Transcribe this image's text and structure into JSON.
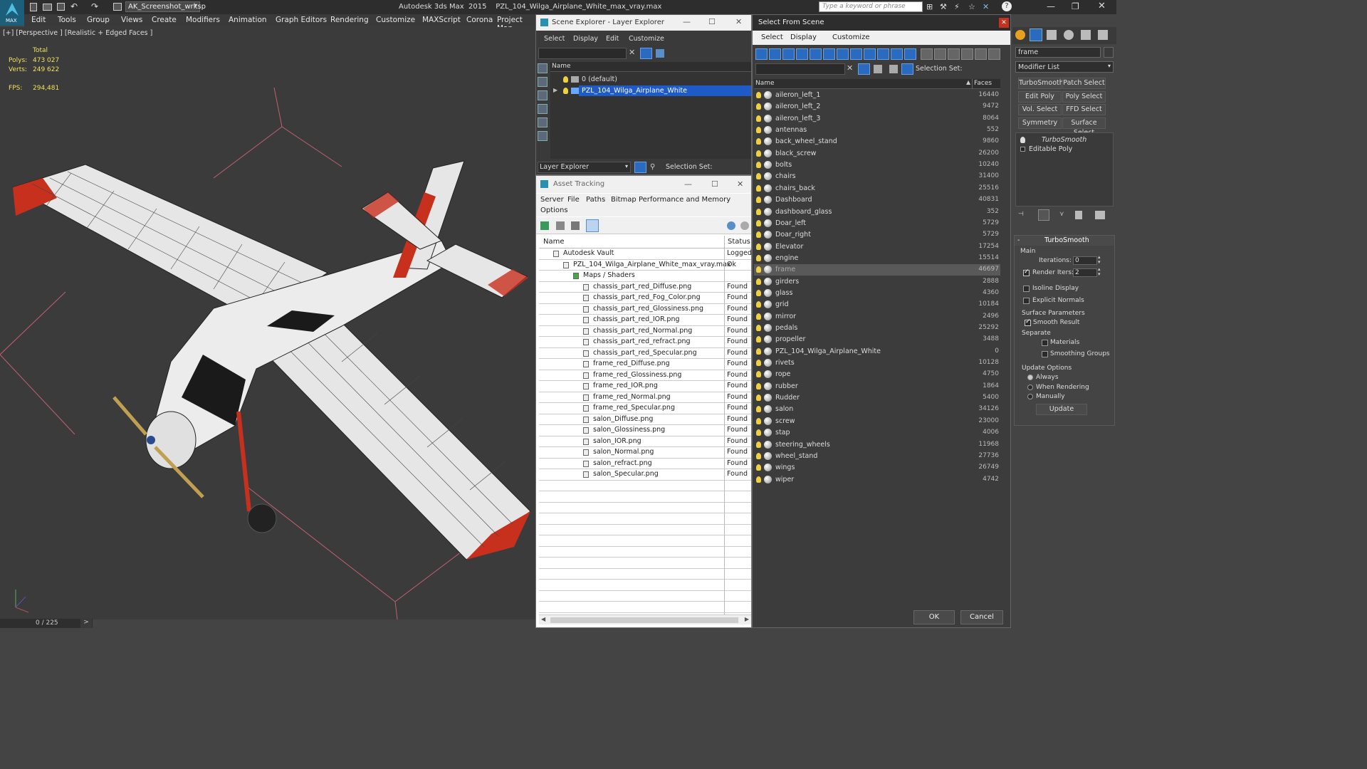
{
  "app": {
    "title": "Autodesk 3ds Max  2015    PZL_104_Wilga_Airplane_White_max_vray.max",
    "workspace": "AK_Screenshot_wrksp",
    "search_placeholder": "Type a keyword or phrase",
    "logo_text": "MAX"
  },
  "menu": [
    "Edit",
    "Tools",
    "Group",
    "Views",
    "Create",
    "Modifiers",
    "Animation",
    "Graph Editors",
    "Rendering",
    "Customize",
    "MAXScript",
    "Corona",
    "Project Man"
  ],
  "viewport": {
    "label": "[+] [Perspective ] [Realistic + Edged Faces ]",
    "stats_header": "Total",
    "polys_label": "Polys:",
    "polys_value": "473 027",
    "verts_label": "Verts:",
    "verts_value": "249 622",
    "fps_label": "FPS:",
    "fps_value": "294,481"
  },
  "timeline": {
    "frame": "0 / 225",
    "next": ">"
  },
  "scene_explorer": {
    "title": "Scene Explorer - Layer Explorer",
    "menu": [
      "Select",
      "Display",
      "Edit",
      "Customize"
    ],
    "col_name": "Name",
    "layers": [
      "0 (default)",
      "PZL_104_Wilga_Airplane_White"
    ],
    "footer_label": "Layer Explorer",
    "selection_set": "Selection Set:"
  },
  "asset_tracking": {
    "title": "Asset Tracking",
    "menu": [
      "Server",
      "File",
      "Paths",
      "Bitmap Performance and Memory"
    ],
    "menu2": "Options",
    "col_name": "Name",
    "col_status": "Status",
    "rows": [
      {
        "name": "Autodesk Vault",
        "status": "Logged",
        "indent": 0
      },
      {
        "name": "PZL_104_Wilga_Airplane_White_max_vray.max",
        "status": "Ok",
        "indent": 1
      },
      {
        "name": "Maps / Shaders",
        "status": "",
        "indent": 2
      },
      {
        "name": "chassis_part_red_Diffuse.png",
        "status": "Found",
        "indent": 3
      },
      {
        "name": "chassis_part_red_Fog_Color.png",
        "status": "Found",
        "indent": 3
      },
      {
        "name": "chassis_part_red_Glossiness.png",
        "status": "Found",
        "indent": 3
      },
      {
        "name": "chassis_part_red_IOR.png",
        "status": "Found",
        "indent": 3
      },
      {
        "name": "chassis_part_red_Normal.png",
        "status": "Found",
        "indent": 3
      },
      {
        "name": "chassis_part_red_refract.png",
        "status": "Found",
        "indent": 3
      },
      {
        "name": "chassis_part_red_Specular.png",
        "status": "Found",
        "indent": 3
      },
      {
        "name": "frame_red_Diffuse.png",
        "status": "Found",
        "indent": 3
      },
      {
        "name": "frame_red_Glossiness.png",
        "status": "Found",
        "indent": 3
      },
      {
        "name": "frame_red_IOR.png",
        "status": "Found",
        "indent": 3
      },
      {
        "name": "frame_red_Normal.png",
        "status": "Found",
        "indent": 3
      },
      {
        "name": "frame_red_Specular.png",
        "status": "Found",
        "indent": 3
      },
      {
        "name": "salon_Diffuse.png",
        "status": "Found",
        "indent": 3
      },
      {
        "name": "salon_Glossiness.png",
        "status": "Found",
        "indent": 3
      },
      {
        "name": "salon_IOR.png",
        "status": "Found",
        "indent": 3
      },
      {
        "name": "salon_Normal.png",
        "status": "Found",
        "indent": 3
      },
      {
        "name": "salon_refract.png",
        "status": "Found",
        "indent": 3
      },
      {
        "name": "salon_Specular.png",
        "status": "Found",
        "indent": 3
      }
    ]
  },
  "select_from_scene": {
    "title": "Select From Scene",
    "menu": [
      "Select",
      "Display",
      "Customize"
    ],
    "selection_set": "Selection Set:",
    "col_name": "Name",
    "col_faces": "Faces",
    "ok": "OK",
    "cancel": "Cancel",
    "objects": [
      {
        "name": "aileron_left_1",
        "faces": "16440"
      },
      {
        "name": "aileron_left_2",
        "faces": "9472"
      },
      {
        "name": "aileron_left_3",
        "faces": "8064"
      },
      {
        "name": "antennas",
        "faces": "552"
      },
      {
        "name": "back_wheel_stand",
        "faces": "9860"
      },
      {
        "name": "black_screw",
        "faces": "26200"
      },
      {
        "name": "bolts",
        "faces": "10240"
      },
      {
        "name": "chairs",
        "faces": "31400"
      },
      {
        "name": "chairs_back",
        "faces": "25516"
      },
      {
        "name": "Dashboard",
        "faces": "40831"
      },
      {
        "name": "dashboard_glass",
        "faces": "352"
      },
      {
        "name": "Doar_left",
        "faces": "5729"
      },
      {
        "name": "Doar_right",
        "faces": "5729"
      },
      {
        "name": "Elevator",
        "faces": "17254"
      },
      {
        "name": "engine",
        "faces": "15514"
      },
      {
        "name": "frame",
        "faces": "46697",
        "selected": true
      },
      {
        "name": "girders",
        "faces": "2888"
      },
      {
        "name": "glass",
        "faces": "4360"
      },
      {
        "name": "grid",
        "faces": "10184"
      },
      {
        "name": "mirror",
        "faces": "2496"
      },
      {
        "name": "pedals",
        "faces": "25292"
      },
      {
        "name": "propeller",
        "faces": "3488"
      },
      {
        "name": "PZL_104_Wilga_Airplane_White",
        "faces": "0",
        "group": true
      },
      {
        "name": "rivets",
        "faces": "10128"
      },
      {
        "name": "rope",
        "faces": "4750"
      },
      {
        "name": "rubber",
        "faces": "1864"
      },
      {
        "name": "Rudder",
        "faces": "5400"
      },
      {
        "name": "salon",
        "faces": "34126"
      },
      {
        "name": "screw",
        "faces": "23000"
      },
      {
        "name": "stap",
        "faces": "4006"
      },
      {
        "name": "steering_wheels",
        "faces": "11968"
      },
      {
        "name": "wheel_stand",
        "faces": "27736"
      },
      {
        "name": "wings",
        "faces": "26749"
      },
      {
        "name": "wiper",
        "faces": "4742"
      }
    ]
  },
  "modify_panel": {
    "object_name": "frame",
    "modifier_list": "Modifier List",
    "buttons": [
      "TurboSmooth",
      "Patch Select",
      "Edit Poly",
      "Poly Select",
      "Vol. Select",
      "FFD Select",
      "Symmetry",
      "Surface Select"
    ],
    "stack": [
      "TurboSmooth",
      "Editable Poly"
    ],
    "rollout_title": "TurboSmooth",
    "main_label": "Main",
    "iterations_label": "Iterations:",
    "iterations_value": "0",
    "render_iters_label": "Render Iters:",
    "render_iters_value": "2",
    "isoline": "Isoline Display",
    "explicit_normals": "Explicit Normals",
    "surface_params": "Surface Parameters",
    "smooth_result": "Smooth Result",
    "separate": "Separate",
    "materials": "Materials",
    "smoothing_groups": "Smoothing Groups",
    "update_options": "Update Options",
    "always": "Always",
    "when_rendering": "When Rendering",
    "manually": "Manually",
    "update": "Update",
    "collapse": "-"
  },
  "colors": {
    "accent": "#2a6bc0",
    "selected_row": "#1e5bc6",
    "red": "#c8301e"
  }
}
